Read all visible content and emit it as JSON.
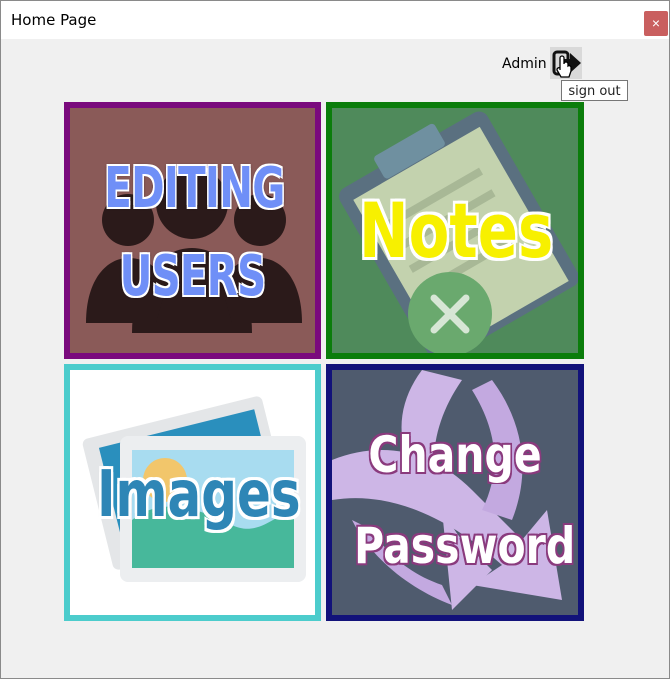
{
  "window": {
    "title": "Home Page",
    "close_glyph": "×"
  },
  "header": {
    "user_label": "Admin",
    "signout_icon": "sign-out-icon",
    "signout_tooltip": "sign out"
  },
  "tiles": [
    {
      "line1": "EDITING",
      "line2": "USERS",
      "icon": "users-icon",
      "border_color": "#7a0a7d"
    },
    {
      "label": "Notes",
      "icon": "clipboard-icon",
      "border_color": "#0b7d0b"
    },
    {
      "label": "Images",
      "icon": "images-icon",
      "border_color": "#4ccccc"
    },
    {
      "line1": "Change",
      "line2": "Password",
      "icon": "arrows-icon",
      "border_color": "#12127a"
    }
  ]
}
